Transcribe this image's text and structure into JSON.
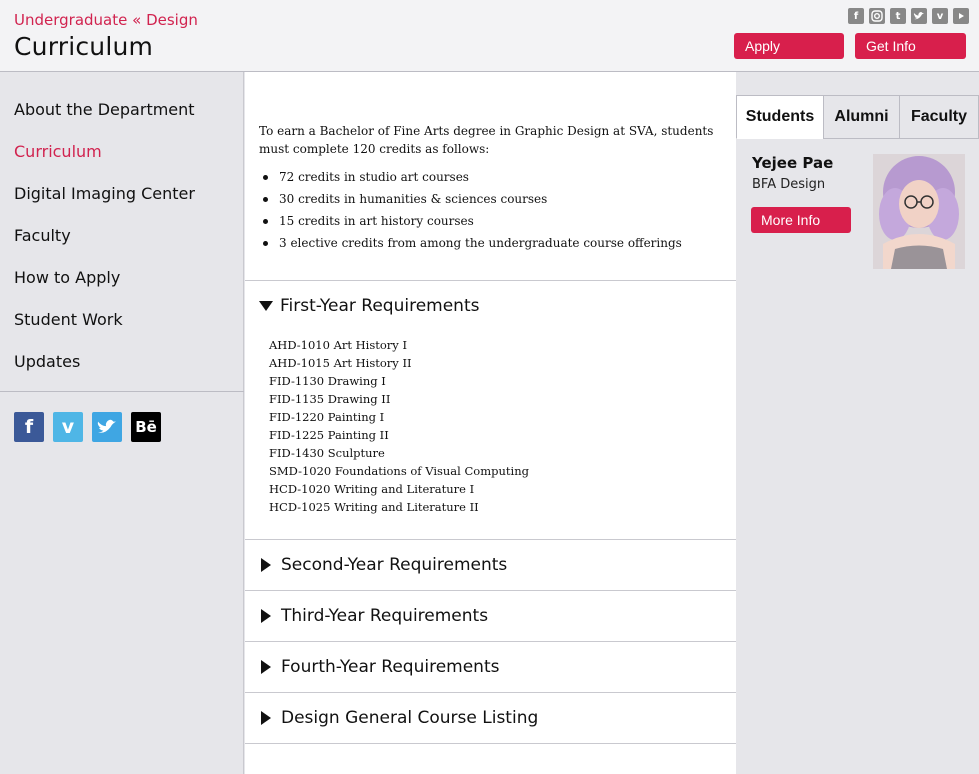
{
  "header": {
    "breadcrumb": "Undergraduate « Design",
    "title": "Curriculum",
    "social_icons": [
      "facebook-icon",
      "instagram-icon",
      "tumblr-icon",
      "twitter-icon",
      "vimeo-icon",
      "youtube-icon"
    ],
    "apply_label": "Apply",
    "getinfo_label": "Get Info"
  },
  "sidebar": {
    "items": [
      {
        "label": "About the Department",
        "active": false
      },
      {
        "label": "Curriculum",
        "active": true
      },
      {
        "label": "Digital Imaging Center",
        "active": false
      },
      {
        "label": "Faculty",
        "active": false
      },
      {
        "label": "How to Apply",
        "active": false
      },
      {
        "label": "Student Work",
        "active": false
      },
      {
        "label": "Updates",
        "active": false
      }
    ],
    "social": {
      "facebook": "f",
      "vimeo": "v",
      "twitter": "t",
      "behance": "Bē"
    }
  },
  "main": {
    "intro": "To earn a Bachelor of Fine Arts degree in Graphic Design at SVA, students must complete 120 credits as follows:",
    "bullets": [
      "72 credits in studio art courses",
      "30 credits in humanities & sciences courses",
      "15 credits in art history courses",
      "3 elective credits from among the undergraduate course offerings"
    ],
    "sections": [
      {
        "label": "First-Year Requirements",
        "expanded": true
      },
      {
        "label": "Second-Year Requirements",
        "expanded": false
      },
      {
        "label": "Third-Year Requirements",
        "expanded": false
      },
      {
        "label": "Fourth-Year Requirements",
        "expanded": false
      },
      {
        "label": "Design General Course Listing",
        "expanded": false
      }
    ],
    "first_year_courses": [
      "AHD-1010 Art History I",
      "AHD-1015 Art History II",
      "FID-1130 Drawing I",
      "FID-1135 Drawing II",
      "FID-1220 Painting I",
      "FID-1225 Painting II",
      "FID-1430 Sculpture",
      "SMD-1020 Foundations of Visual Computing",
      "HCD-1020 Writing and Literature I",
      "HCD-1025 Writing and Literature II"
    ]
  },
  "right_panel": {
    "tabs": [
      {
        "label": "Students",
        "active": true
      },
      {
        "label": "Alumni",
        "active": false
      },
      {
        "label": "Faculty",
        "active": false
      }
    ],
    "profile": {
      "name": "Yejee Pae",
      "degree": "BFA Design",
      "more_label": "More Info"
    }
  },
  "colors": {
    "accent": "#d81f4c",
    "link_active": "#d1234f",
    "sidebar_bg": "#e6e6ea"
  }
}
